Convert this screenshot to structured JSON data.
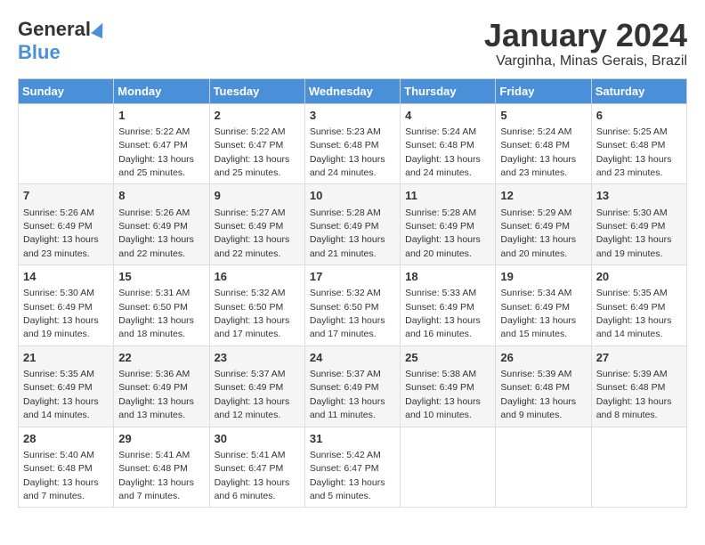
{
  "header": {
    "logo_general": "General",
    "logo_blue": "Blue",
    "month_title": "January 2024",
    "location": "Varginha, Minas Gerais, Brazil"
  },
  "weekdays": [
    "Sunday",
    "Monday",
    "Tuesday",
    "Wednesday",
    "Thursday",
    "Friday",
    "Saturday"
  ],
  "weeks": [
    [
      {
        "day": "",
        "sunrise": "",
        "sunset": "",
        "daylight": ""
      },
      {
        "day": "1",
        "sunrise": "Sunrise: 5:22 AM",
        "sunset": "Sunset: 6:47 PM",
        "daylight": "Daylight: 13 hours and 25 minutes."
      },
      {
        "day": "2",
        "sunrise": "Sunrise: 5:22 AM",
        "sunset": "Sunset: 6:47 PM",
        "daylight": "Daylight: 13 hours and 25 minutes."
      },
      {
        "day": "3",
        "sunrise": "Sunrise: 5:23 AM",
        "sunset": "Sunset: 6:48 PM",
        "daylight": "Daylight: 13 hours and 24 minutes."
      },
      {
        "day": "4",
        "sunrise": "Sunrise: 5:24 AM",
        "sunset": "Sunset: 6:48 PM",
        "daylight": "Daylight: 13 hours and 24 minutes."
      },
      {
        "day": "5",
        "sunrise": "Sunrise: 5:24 AM",
        "sunset": "Sunset: 6:48 PM",
        "daylight": "Daylight: 13 hours and 23 minutes."
      },
      {
        "day": "6",
        "sunrise": "Sunrise: 5:25 AM",
        "sunset": "Sunset: 6:48 PM",
        "daylight": "Daylight: 13 hours and 23 minutes."
      }
    ],
    [
      {
        "day": "7",
        "sunrise": "Sunrise: 5:26 AM",
        "sunset": "Sunset: 6:49 PM",
        "daylight": "Daylight: 13 hours and 23 minutes."
      },
      {
        "day": "8",
        "sunrise": "Sunrise: 5:26 AM",
        "sunset": "Sunset: 6:49 PM",
        "daylight": "Daylight: 13 hours and 22 minutes."
      },
      {
        "day": "9",
        "sunrise": "Sunrise: 5:27 AM",
        "sunset": "Sunset: 6:49 PM",
        "daylight": "Daylight: 13 hours and 22 minutes."
      },
      {
        "day": "10",
        "sunrise": "Sunrise: 5:28 AM",
        "sunset": "Sunset: 6:49 PM",
        "daylight": "Daylight: 13 hours and 21 minutes."
      },
      {
        "day": "11",
        "sunrise": "Sunrise: 5:28 AM",
        "sunset": "Sunset: 6:49 PM",
        "daylight": "Daylight: 13 hours and 20 minutes."
      },
      {
        "day": "12",
        "sunrise": "Sunrise: 5:29 AM",
        "sunset": "Sunset: 6:49 PM",
        "daylight": "Daylight: 13 hours and 20 minutes."
      },
      {
        "day": "13",
        "sunrise": "Sunrise: 5:30 AM",
        "sunset": "Sunset: 6:49 PM",
        "daylight": "Daylight: 13 hours and 19 minutes."
      }
    ],
    [
      {
        "day": "14",
        "sunrise": "Sunrise: 5:30 AM",
        "sunset": "Sunset: 6:49 PM",
        "daylight": "Daylight: 13 hours and 19 minutes."
      },
      {
        "day": "15",
        "sunrise": "Sunrise: 5:31 AM",
        "sunset": "Sunset: 6:50 PM",
        "daylight": "Daylight: 13 hours and 18 minutes."
      },
      {
        "day": "16",
        "sunrise": "Sunrise: 5:32 AM",
        "sunset": "Sunset: 6:50 PM",
        "daylight": "Daylight: 13 hours and 17 minutes."
      },
      {
        "day": "17",
        "sunrise": "Sunrise: 5:32 AM",
        "sunset": "Sunset: 6:50 PM",
        "daylight": "Daylight: 13 hours and 17 minutes."
      },
      {
        "day": "18",
        "sunrise": "Sunrise: 5:33 AM",
        "sunset": "Sunset: 6:49 PM",
        "daylight": "Daylight: 13 hours and 16 minutes."
      },
      {
        "day": "19",
        "sunrise": "Sunrise: 5:34 AM",
        "sunset": "Sunset: 6:49 PM",
        "daylight": "Daylight: 13 hours and 15 minutes."
      },
      {
        "day": "20",
        "sunrise": "Sunrise: 5:35 AM",
        "sunset": "Sunset: 6:49 PM",
        "daylight": "Daylight: 13 hours and 14 minutes."
      }
    ],
    [
      {
        "day": "21",
        "sunrise": "Sunrise: 5:35 AM",
        "sunset": "Sunset: 6:49 PM",
        "daylight": "Daylight: 13 hours and 14 minutes."
      },
      {
        "day": "22",
        "sunrise": "Sunrise: 5:36 AM",
        "sunset": "Sunset: 6:49 PM",
        "daylight": "Daylight: 13 hours and 13 minutes."
      },
      {
        "day": "23",
        "sunrise": "Sunrise: 5:37 AM",
        "sunset": "Sunset: 6:49 PM",
        "daylight": "Daylight: 13 hours and 12 minutes."
      },
      {
        "day": "24",
        "sunrise": "Sunrise: 5:37 AM",
        "sunset": "Sunset: 6:49 PM",
        "daylight": "Daylight: 13 hours and 11 minutes."
      },
      {
        "day": "25",
        "sunrise": "Sunrise: 5:38 AM",
        "sunset": "Sunset: 6:49 PM",
        "daylight": "Daylight: 13 hours and 10 minutes."
      },
      {
        "day": "26",
        "sunrise": "Sunrise: 5:39 AM",
        "sunset": "Sunset: 6:48 PM",
        "daylight": "Daylight: 13 hours and 9 minutes."
      },
      {
        "day": "27",
        "sunrise": "Sunrise: 5:39 AM",
        "sunset": "Sunset: 6:48 PM",
        "daylight": "Daylight: 13 hours and 8 minutes."
      }
    ],
    [
      {
        "day": "28",
        "sunrise": "Sunrise: 5:40 AM",
        "sunset": "Sunset: 6:48 PM",
        "daylight": "Daylight: 13 hours and 7 minutes."
      },
      {
        "day": "29",
        "sunrise": "Sunrise: 5:41 AM",
        "sunset": "Sunset: 6:48 PM",
        "daylight": "Daylight: 13 hours and 7 minutes."
      },
      {
        "day": "30",
        "sunrise": "Sunrise: 5:41 AM",
        "sunset": "Sunset: 6:47 PM",
        "daylight": "Daylight: 13 hours and 6 minutes."
      },
      {
        "day": "31",
        "sunrise": "Sunrise: 5:42 AM",
        "sunset": "Sunset: 6:47 PM",
        "daylight": "Daylight: 13 hours and 5 minutes."
      },
      {
        "day": "",
        "sunrise": "",
        "sunset": "",
        "daylight": ""
      },
      {
        "day": "",
        "sunrise": "",
        "sunset": "",
        "daylight": ""
      },
      {
        "day": "",
        "sunrise": "",
        "sunset": "",
        "daylight": ""
      }
    ]
  ]
}
